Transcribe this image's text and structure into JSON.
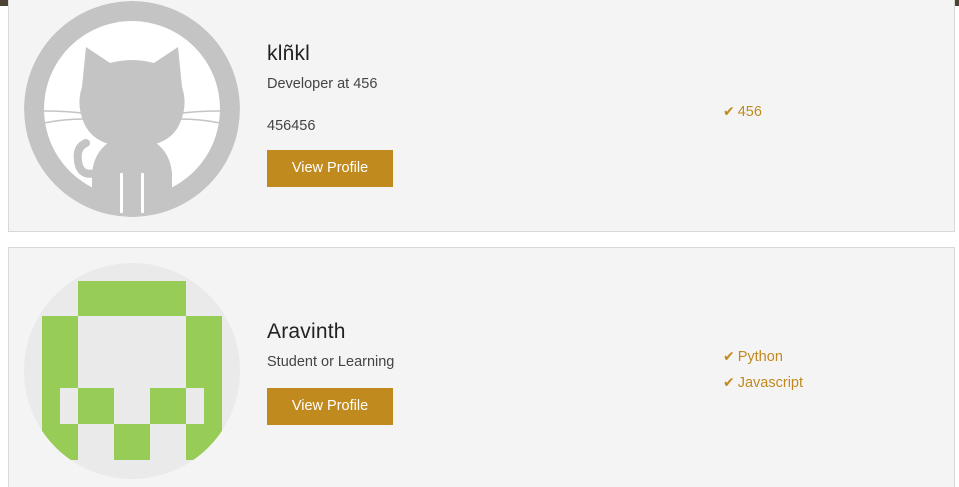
{
  "colors": {
    "accent": "#c08a1f",
    "topbar": "#4d4434",
    "card_bg": "#f4f4f4",
    "avatar_gray": "#c4c4c4",
    "avatar_green": "#97cc56"
  },
  "profiles": [
    {
      "name": "klñkl",
      "title": "Developer at 456",
      "location": "456456",
      "button_label": "View Profile",
      "avatar_icon": "github-octocat-icon",
      "skills": [
        "456"
      ]
    },
    {
      "name": "Aravinth",
      "title": "Student or Learning",
      "button_label": "View Profile",
      "avatar_icon": "identicon",
      "skills": [
        "Python",
        "Javascript"
      ]
    }
  ],
  "skill_icon": "check-icon"
}
